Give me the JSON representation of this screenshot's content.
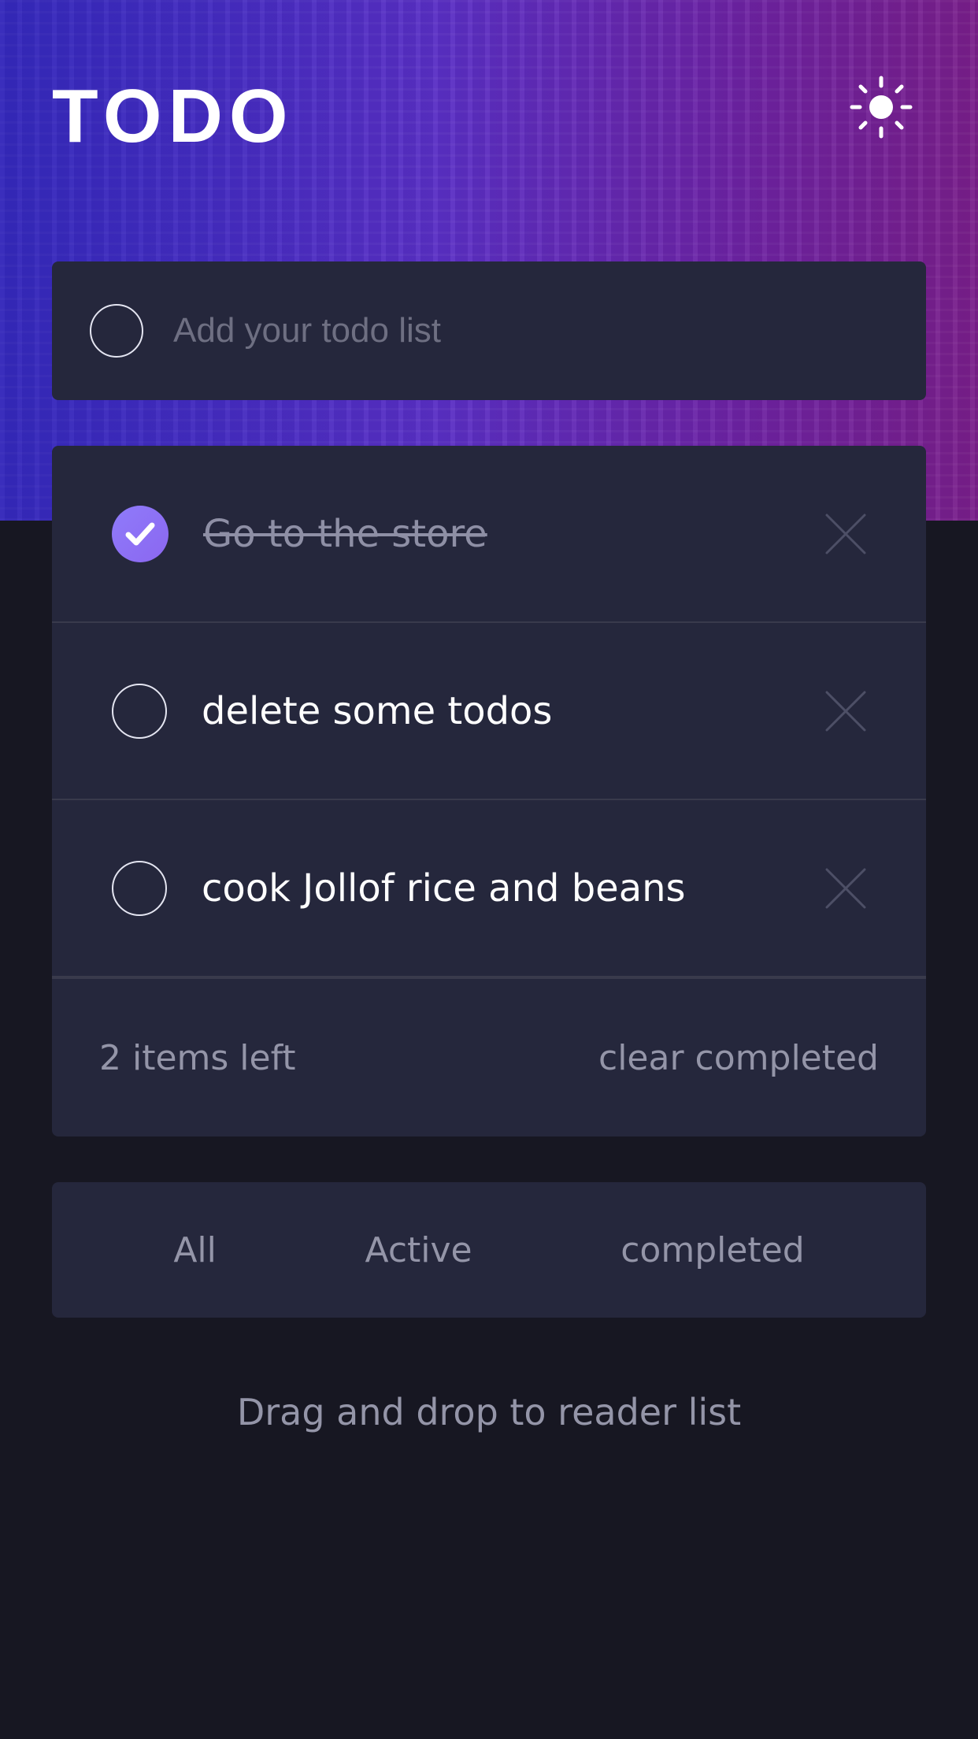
{
  "header": {
    "title": "TODO",
    "theme_icon": "sun-icon"
  },
  "new_todo": {
    "placeholder": "Add your todo list"
  },
  "todos": [
    {
      "text": "Go to the store",
      "completed": true
    },
    {
      "text": "delete some todos",
      "completed": false
    },
    {
      "text": "cook Jollof rice and beans",
      "completed": false
    }
  ],
  "footer": {
    "items_left": "2 items left",
    "clear_label": "clear completed"
  },
  "filters": {
    "all": "All",
    "active": "Active",
    "completed": "completed"
  },
  "hint": "Drag and drop to reader list",
  "colors": {
    "accent": "#8b6cf5",
    "card": "#25273c",
    "background": "#171722",
    "muted_text": "#9495a8"
  }
}
